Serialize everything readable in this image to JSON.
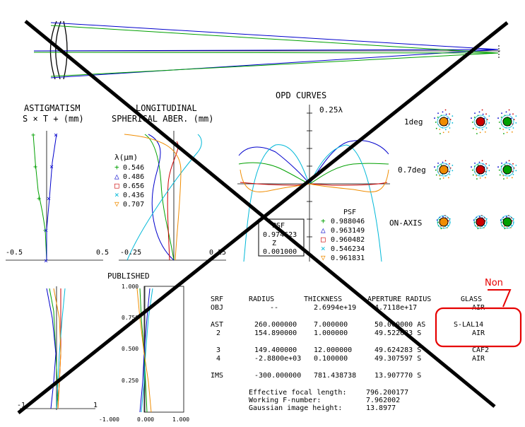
{
  "colors": {
    "green": "#00a000",
    "blue": "#0000cc",
    "red": "#cc0000",
    "cyan": "#00b8d8",
    "orange": "#f08c00",
    "annotation_red": "#e60000",
    "black": "#000000"
  },
  "astig": {
    "title": "ASTIGMATISM",
    "legend": "S × T + (mm)",
    "xmin_label": "-0.5",
    "xmax_label": "0.5"
  },
  "longit": {
    "title": "LONGITUDINAL",
    "subtitle": "SPHERICAL ABER. (mm)",
    "wave_header": "λ(μm)",
    "wavelengths": [
      {
        "symbol": "+",
        "value": "0.546",
        "color": "green"
      },
      {
        "symbol": "△",
        "value": "0.486",
        "color": "blue"
      },
      {
        "symbol": "□",
        "value": "0.656",
        "color": "red"
      },
      {
        "symbol": "×",
        "value": "0.436",
        "color": "cyan"
      },
      {
        "symbol": "▽",
        "value": "0.707",
        "color": "orange"
      }
    ],
    "xmin_label": "-0.25",
    "xmax_label": "0.25"
  },
  "opd": {
    "title": "OPD CURVES",
    "scale_label": "0.25λ",
    "psf_box": {
      "psf_label": "PSF",
      "psf_value": "0.974623",
      "z_label": "Z",
      "z_value": "0.001000"
    },
    "psf_header": "PSF",
    "psf_values": [
      {
        "symbol": "+",
        "value": "0.988046",
        "color": "green"
      },
      {
        "symbol": "△",
        "value": "0.963149",
        "color": "blue"
      },
      {
        "symbol": "□",
        "value": "0.960482",
        "color": "red"
      },
      {
        "symbol": "×",
        "value": "0.546234",
        "color": "cyan"
      },
      {
        "symbol": "▽",
        "value": "0.961831",
        "color": "orange"
      }
    ]
  },
  "spots": {
    "rows": [
      "1deg",
      "0.7deg",
      "ON-AXIS"
    ]
  },
  "published": {
    "title": "PUBLISHED",
    "y_ticks": [
      "1.000",
      "0.750",
      "0.500",
      "0.250"
    ],
    "x_ticks": [
      "-1.000",
      "0.000",
      "1.000"
    ],
    "left_x_min": "-1",
    "left_x_max": "1"
  },
  "table": {
    "headers": [
      "SRF",
      "RADIUS",
      "THICKNESS",
      "APERTURE RADIUS",
      "GLASS"
    ],
    "rows": [
      [
        "OBJ",
        "--",
        "2.6994e+19",
        "4.7118e+17",
        "AIR"
      ],
      [
        "AST",
        "260.000000",
        "7.000000",
        "50.000000 AS",
        "S-LAL14"
      ],
      [
        "2",
        "154.890000",
        "1.000000",
        "49.522683 S",
        "AIR"
      ],
      [
        "3",
        "149.400000",
        "12.000000",
        "49.624283 S",
        "CAF2"
      ],
      [
        "4",
        "-2.8800e+03",
        "0.100000",
        "49.307597 S",
        "AIR"
      ],
      [
        "IMS",
        "-300.000000",
        "781.438738",
        "13.907770 S",
        ""
      ]
    ],
    "summary": [
      {
        "label": "Effective focal length:",
        "value": "796.200177"
      },
      {
        "label": "Working F-number:",
        "value": "7.962002"
      },
      {
        "label": "Gaussian image height:",
        "value": "13.8977"
      }
    ]
  },
  "annotation": {
    "text": "Non"
  }
}
